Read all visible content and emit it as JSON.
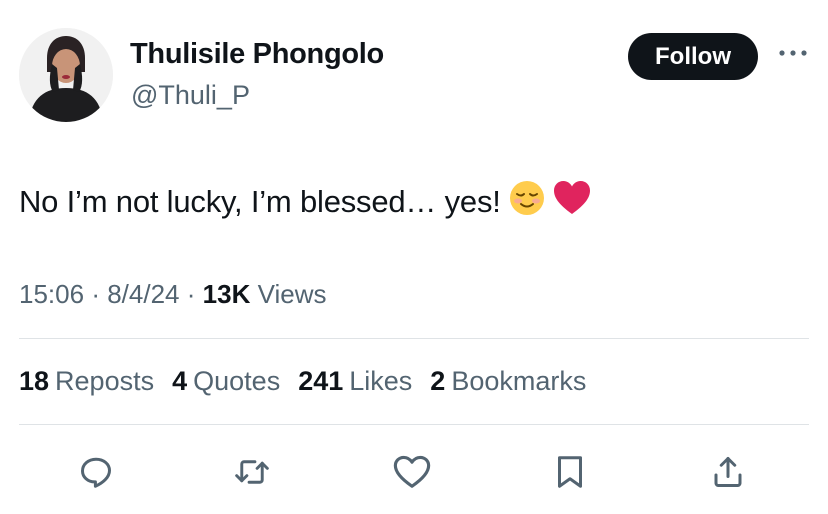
{
  "author": {
    "name": "Thulisile Phongolo",
    "handle": "@Thuli_P"
  },
  "follow_label": "Follow",
  "tweet": {
    "text": "No I’m not lucky, I’m blessed… yes!",
    "emojis": [
      "smiling-blush-emoji",
      "red-heart-emoji"
    ]
  },
  "meta": {
    "time": "15:06",
    "sep1": "·",
    "date": "8/4/24",
    "sep2": "·",
    "views_count": "13K",
    "views_label": "Views"
  },
  "stats": {
    "reposts_count": "18",
    "reposts_label": "Reposts",
    "quotes_count": "4",
    "quotes_label": "Quotes",
    "likes_count": "241",
    "likes_label": "Likes",
    "bookmarks_count": "2",
    "bookmarks_label": "Bookmarks"
  },
  "actions": [
    "reply-icon",
    "repost-icon",
    "like-icon",
    "bookmark-icon",
    "share-icon"
  ],
  "colors": {
    "text": "#0f1419",
    "secondary": "#536471",
    "divider": "#dfe3e6",
    "follow_bg": "#0f1419",
    "heart": "#e0245e"
  }
}
